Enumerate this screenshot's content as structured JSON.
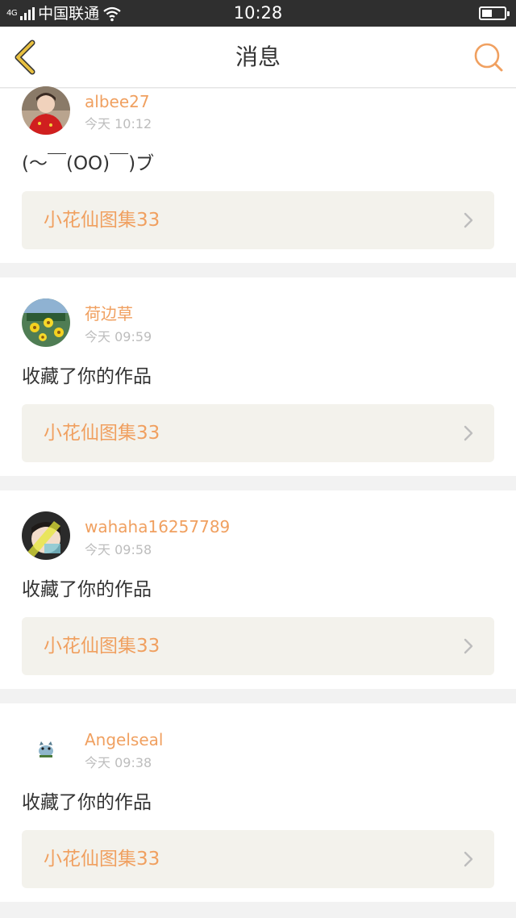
{
  "status_bar": {
    "network": "4G",
    "carrier": "中国联通",
    "time": "10:28",
    "battery_level": 0.45,
    "wifi_icon": "wifi-icon",
    "signal_icon": "signal-icon"
  },
  "nav": {
    "title": "消息",
    "back_icon": "chevron-left-icon",
    "search_icon": "search-icon"
  },
  "colors": {
    "accent": "#f0a060",
    "back_arrow": "#e8c040",
    "text_primary": "#333333",
    "text_secondary": "#bdbdbd",
    "card_box": "#f3f2ec",
    "page_bg": "#f2f2f2",
    "status_bar": "#2f2f2f"
  },
  "messages": [
    {
      "username": "albee27",
      "time": "今天 10:12",
      "text": "(～￣(OO)￣)ブ",
      "work_title": "小花仙图集33",
      "avatar_icon": "avatar-red-dress"
    },
    {
      "username": "荷边草",
      "time": "今天 09:59",
      "text": "收藏了你的作品",
      "work_title": "小花仙图集33",
      "avatar_icon": "avatar-yellow-flowers"
    },
    {
      "username": "wahaha16257789",
      "time": "今天 09:58",
      "text": "收藏了你的作品",
      "work_title": "小花仙图集33",
      "avatar_icon": "avatar-child-photo"
    },
    {
      "username": "Angelseal",
      "time": "今天 09:38",
      "text": "收藏了你的作品",
      "work_title": "小花仙图集33",
      "avatar_icon": "avatar-small-sticker"
    }
  ]
}
